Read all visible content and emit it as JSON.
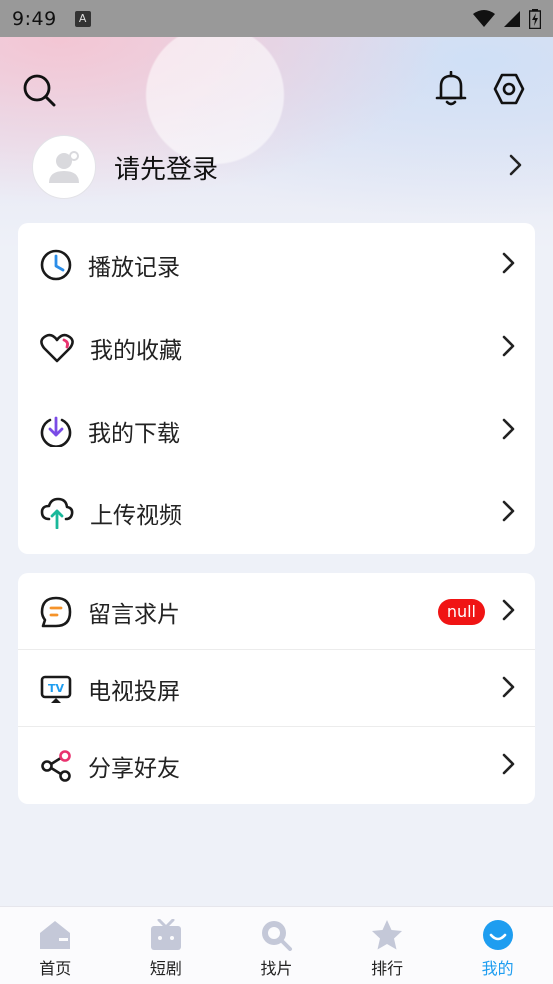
{
  "status_bar": {
    "time": "9:49",
    "notification_glyph": "A"
  },
  "header": {
    "search_icon": "search-icon",
    "bell_icon": "bell-icon",
    "settings_icon": "hexagon-settings-icon"
  },
  "profile": {
    "login_text": "请先登录",
    "avatar_icon": "default-avatar-icon"
  },
  "menu_primary": [
    {
      "label": "播放记录",
      "icon": "clock-icon"
    },
    {
      "label": "我的收藏",
      "icon": "heart-icon"
    },
    {
      "label": "我的下载",
      "icon": "download-icon"
    },
    {
      "label": "上传视频",
      "icon": "cloud-upload-icon"
    }
  ],
  "menu_secondary": [
    {
      "label": "留言求片",
      "icon": "message-icon",
      "badge": "null"
    },
    {
      "label": "电视投屏",
      "icon": "tv-icon"
    },
    {
      "label": "分享好友",
      "icon": "share-icon"
    }
  ],
  "tabbar": {
    "tabs": [
      {
        "label": "首页",
        "icon": "home-icon"
      },
      {
        "label": "短剧",
        "icon": "tv-box-icon"
      },
      {
        "label": "找片",
        "icon": "search-icon"
      },
      {
        "label": "排行",
        "icon": "star-icon"
      },
      {
        "label": "我的",
        "icon": "profile-smile-icon"
      }
    ],
    "active_index": 4,
    "active_color": "#1e9df0",
    "inactive_color": "#c4c8d8"
  }
}
